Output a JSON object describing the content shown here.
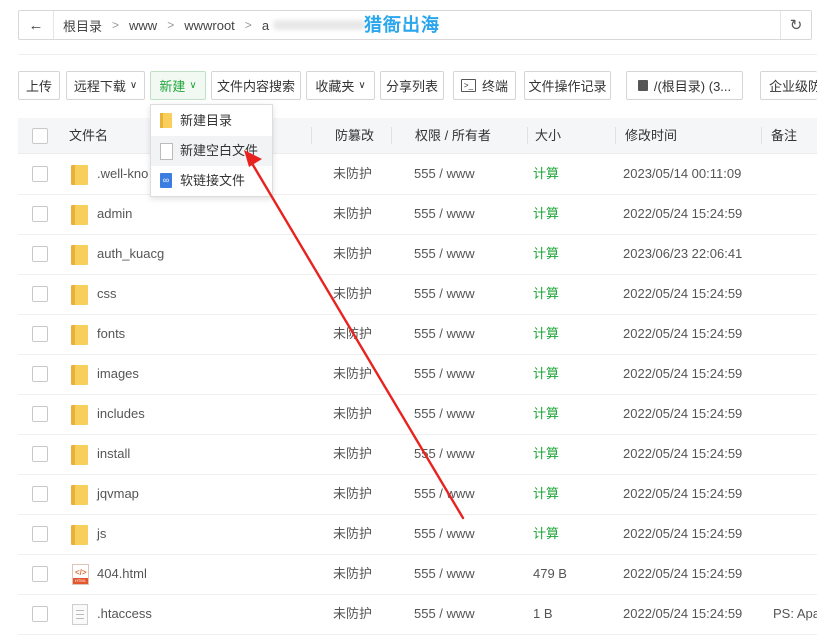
{
  "breadcrumbs": [
    "根目录",
    "www",
    "wwwroot",
    "a"
  ],
  "watermark": "猎衙出海",
  "toolbar": {
    "upload": "上传",
    "remote_download": "远程下载",
    "new": "新建",
    "content_search": "文件内容搜索",
    "favorites": "收藏夹",
    "share_list": "分享列表",
    "terminal": "终端",
    "file_log": "文件操作记录",
    "disk": "/(根目录) (3...",
    "enterprise": "企业级防"
  },
  "new_menu": [
    "新建目录",
    "新建空白文件",
    "软链接文件"
  ],
  "columns": {
    "name": "文件名",
    "protect": "防篡改",
    "perm": "权限 / 所有者",
    "size": "大小",
    "mtime": "修改时间",
    "note": "备注"
  },
  "rows": [
    {
      "name": ".well-kno",
      "type": "folder",
      "protect": "未防护",
      "perm": "555 / www",
      "size": "计算",
      "mtime": "2023/05/14 00:11:09",
      "note": ""
    },
    {
      "name": "admin",
      "type": "folder",
      "protect": "未防护",
      "perm": "555 / www",
      "size": "计算",
      "mtime": "2022/05/24 15:24:59",
      "note": ""
    },
    {
      "name": "auth_kuacg",
      "type": "folder",
      "protect": "未防护",
      "perm": "555 / www",
      "size": "计算",
      "mtime": "2023/06/23 22:06:41",
      "note": ""
    },
    {
      "name": "css",
      "type": "folder",
      "protect": "未防护",
      "perm": "555 / www",
      "size": "计算",
      "mtime": "2022/05/24 15:24:59",
      "note": ""
    },
    {
      "name": "fonts",
      "type": "folder",
      "protect": "未防护",
      "perm": "555 / www",
      "size": "计算",
      "mtime": "2022/05/24 15:24:59",
      "note": ""
    },
    {
      "name": "images",
      "type": "folder",
      "protect": "未防护",
      "perm": "555 / www",
      "size": "计算",
      "mtime": "2022/05/24 15:24:59",
      "note": ""
    },
    {
      "name": "includes",
      "type": "folder",
      "protect": "未防护",
      "perm": "555 / www",
      "size": "计算",
      "mtime": "2022/05/24 15:24:59",
      "note": ""
    },
    {
      "name": "install",
      "type": "folder",
      "protect": "未防护",
      "perm": "555 / www",
      "size": "计算",
      "mtime": "2022/05/24 15:24:59",
      "note": ""
    },
    {
      "name": "jqvmap",
      "type": "folder",
      "protect": "未防护",
      "perm": "555 / www",
      "size": "计算",
      "mtime": "2022/05/24 15:24:59",
      "note": ""
    },
    {
      "name": "js",
      "type": "folder",
      "protect": "未防护",
      "perm": "555 / www",
      "size": "计算",
      "mtime": "2022/05/24 15:24:59",
      "note": ""
    },
    {
      "name": "404.html",
      "type": "html",
      "protect": "未防护",
      "perm": "555 / www",
      "size": "479 B",
      "mtime": "2022/05/24 15:24:59",
      "note": ""
    },
    {
      "name": ".htaccess",
      "type": "file",
      "protect": "未防护",
      "perm": "555 / www",
      "size": "1 B",
      "mtime": "2022/05/24 15:24:59",
      "note": "PS: Apa"
    }
  ],
  "colors": {
    "accent_green": "#20a53a",
    "arrow_red": "#e8231f",
    "watermark_blue": "#2aa6ee"
  }
}
